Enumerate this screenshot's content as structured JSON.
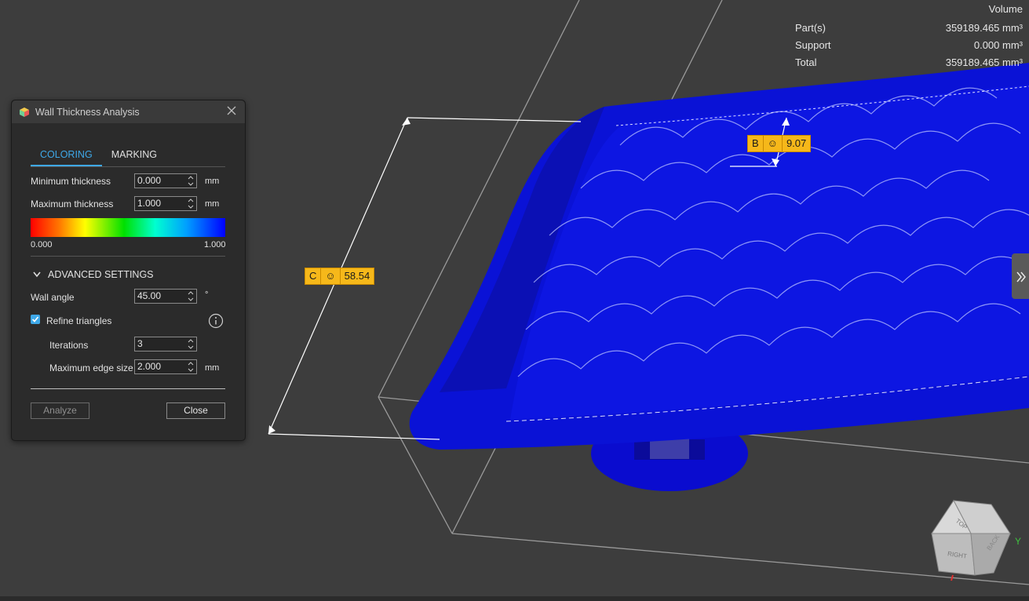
{
  "volume": {
    "title": "Volume",
    "rows": [
      {
        "label": "Part(s)",
        "value": "359189.465 mm³"
      },
      {
        "label": "Support",
        "value": "0.000 mm³"
      },
      {
        "label": "Total",
        "value": "359189.465 mm³"
      }
    ]
  },
  "measurements": [
    {
      "letter": "C",
      "icon": "☺",
      "value": "58.54"
    },
    {
      "letter": "B",
      "icon": "☺",
      "value": "9.07"
    }
  ],
  "dialog": {
    "title": "Wall Thickness Analysis",
    "tabs": [
      "COLORING",
      "MARKING"
    ],
    "min_thickness": {
      "label": "Minimum thickness",
      "value": "0.000",
      "unit": "mm"
    },
    "max_thickness": {
      "label": "Maximum thickness",
      "value": "1.000",
      "unit": "mm"
    },
    "scale": {
      "min": "0.000",
      "max": "1.000"
    },
    "advanced_label": "ADVANCED SETTINGS",
    "wall_angle": {
      "label": "Wall angle",
      "value": "45.00",
      "unit": "°"
    },
    "refine": {
      "label": "Refine triangles",
      "checked": true
    },
    "iterations": {
      "label": "Iterations",
      "value": "3"
    },
    "max_edge": {
      "label": "Maximum edge size",
      "value": "2.000",
      "unit": "mm"
    },
    "analyze_label": "Analyze",
    "close_label": "Close"
  },
  "navcube": {
    "top": "TOP",
    "right": "RIGHT",
    "back": "BACK",
    "y_axis": "Y"
  },
  "colors": {
    "accent": "#3ea8e8",
    "model": "#0a14d8",
    "tag": "#f6b81a"
  }
}
